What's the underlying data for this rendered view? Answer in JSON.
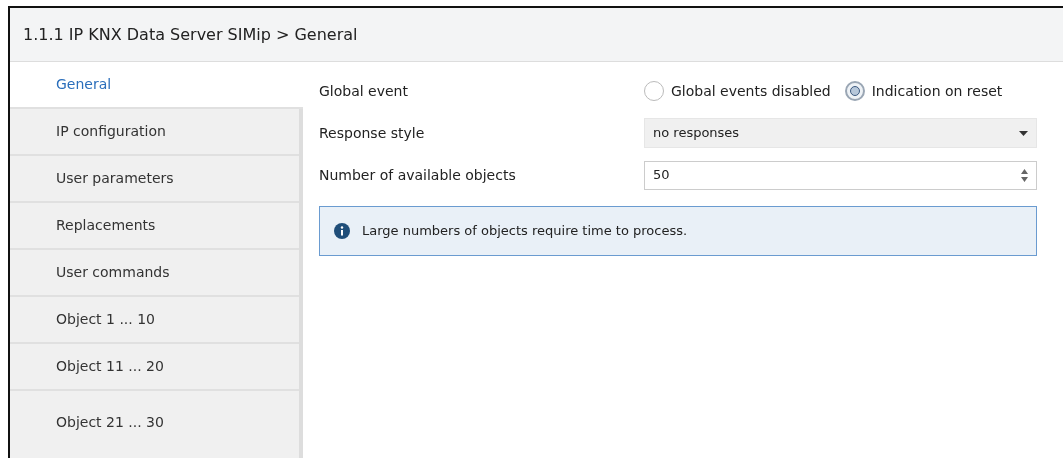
{
  "window": {
    "title": "1.1.1 IP KNX Data Server SIMip > General"
  },
  "sidebar": {
    "items": [
      {
        "label": "General",
        "selected": true
      },
      {
        "label": "IP configuration",
        "selected": false
      },
      {
        "label": "User parameters",
        "selected": false
      },
      {
        "label": "Replacements",
        "selected": false
      },
      {
        "label": "User commands",
        "selected": false
      },
      {
        "label": "Object 1 ... 10",
        "selected": false
      },
      {
        "label": "Object 11 ... 20",
        "selected": false
      },
      {
        "label": "Object 21 ... 30",
        "selected": false
      }
    ]
  },
  "parameters": [
    {
      "kind": "radio",
      "label": "Global event",
      "options": [
        {
          "label": "Global events disabled",
          "selected": false
        },
        {
          "label": "Indication on reset",
          "selected": true
        }
      ]
    },
    {
      "kind": "dropdown",
      "label": "Response style",
      "value": "no responses"
    },
    {
      "kind": "spinner",
      "label": "Number of available objects",
      "value": "50"
    }
  ],
  "info": {
    "text": "Large numbers of objects require time to process."
  }
}
